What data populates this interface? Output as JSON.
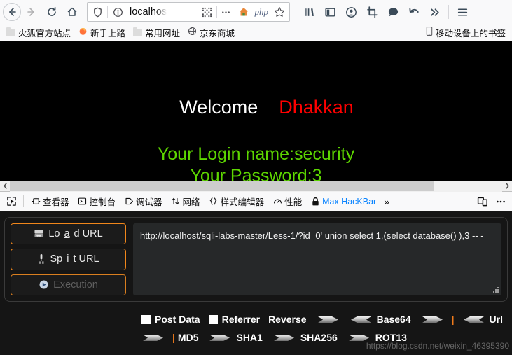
{
  "browser": {
    "nav": {
      "back_label": "Back",
      "forward_label": "Forward",
      "reload_label": "Reload",
      "home_label": "Home"
    },
    "urlbar": {
      "value": "localhost",
      "display_value": "localhos",
      "shield_icon": "shield-icon",
      "info_icon": "info-circle-icon",
      "qr_icon": "qr-code-icon",
      "more_icon": "ellipsis-icon",
      "home_page_icon": "house-icon",
      "php_badge": "php",
      "bookmark_icon": "star-icon"
    },
    "toolbar_icons": [
      {
        "name": "library-icon",
        "label": "Library"
      },
      {
        "name": "sidebar-icon",
        "label": "Sidebars"
      },
      {
        "name": "account-icon",
        "label": "Account"
      },
      {
        "name": "screenshot-icon",
        "label": "Screenshot"
      },
      {
        "name": "chat-bubble-icon",
        "label": "Chat"
      },
      {
        "name": "sync-undo-icon",
        "label": "Sync"
      },
      {
        "name": "overflow-chevrons-icon",
        "label": "More tools"
      },
      {
        "name": "hamburger-menu-icon",
        "label": "Open menu"
      }
    ],
    "bookmarks": [
      {
        "label": "火狐官方站点",
        "icon": "folder-icon"
      },
      {
        "label": "新手上路",
        "icon": "firefox-icon"
      },
      {
        "label": "常用网址",
        "icon": "folder-icon"
      },
      {
        "label": "京东商城",
        "icon": "globe-icon"
      }
    ],
    "bookmarks_right": {
      "label": "移动设备上的书签",
      "icon": "mobile-device-icon"
    }
  },
  "page": {
    "welcome_prefix": "Welcome",
    "welcome_name": "Dhakkan",
    "login_line": "Your Login name:security",
    "password_line": "Your Password:3",
    "colors": {
      "welcome": "#ffffff",
      "name": "#ff0000",
      "green": "#5dd600",
      "background": "#000000"
    }
  },
  "devtools": {
    "picker_icon": "element-picker-icon",
    "tabs": [
      {
        "label": "查看器",
        "icon": "inspector-icon",
        "active": false
      },
      {
        "label": "控制台",
        "icon": "console-icon",
        "active": false
      },
      {
        "label": "调试器",
        "icon": "debugger-icon",
        "active": false
      },
      {
        "label": "网络",
        "icon": "network-icon",
        "active": false
      },
      {
        "label": "样式编辑器",
        "icon": "style-editor-icon",
        "active": false
      },
      {
        "label": "性能",
        "icon": "performance-icon",
        "active": false
      },
      {
        "label": "Max HacKBar",
        "icon": "lock-icon",
        "active": true
      }
    ],
    "overflow_label": "»",
    "responsive_icon": "responsive-design-mode-icon",
    "meatball_icon": "ellipsis-icon",
    "active_tab_color": "#0a84ff"
  },
  "hackbar": {
    "buttons": [
      {
        "label_pre": "Lo",
        "label_u": "a",
        "label_post": "d URL",
        "name": "load-url",
        "icon": "load-url-icon",
        "disabled": false
      },
      {
        "label_pre": "Sp",
        "label_u": "i",
        "label_post": "t URL",
        "name": "spit-url",
        "icon": "split-url-icon",
        "disabled": false
      },
      {
        "label_pre": "Execution",
        "label_u": "",
        "label_post": "",
        "name": "execution",
        "icon": "play-circle-icon",
        "disabled": true
      }
    ],
    "url_value": "http://localhost/sqli-labs-master/Less-1/?id=0' union select 1,(select database() ),3 -- -",
    "row1": {
      "post_data_label": "Post Data",
      "referrer_label": "Referrer",
      "reverse_label": "Reverse",
      "base64_label": "Base64",
      "url_label": "Url",
      "post_data_checked": false,
      "referrer_checked": false
    },
    "row2": {
      "md5_label": "MD5",
      "sha1_label": "SHA1",
      "sha256_label": "SHA256",
      "rot13_label": "ROT13"
    },
    "accent_color": "#f0861b",
    "watermark": "https://blog.csdn.net/weixin_46395390"
  }
}
